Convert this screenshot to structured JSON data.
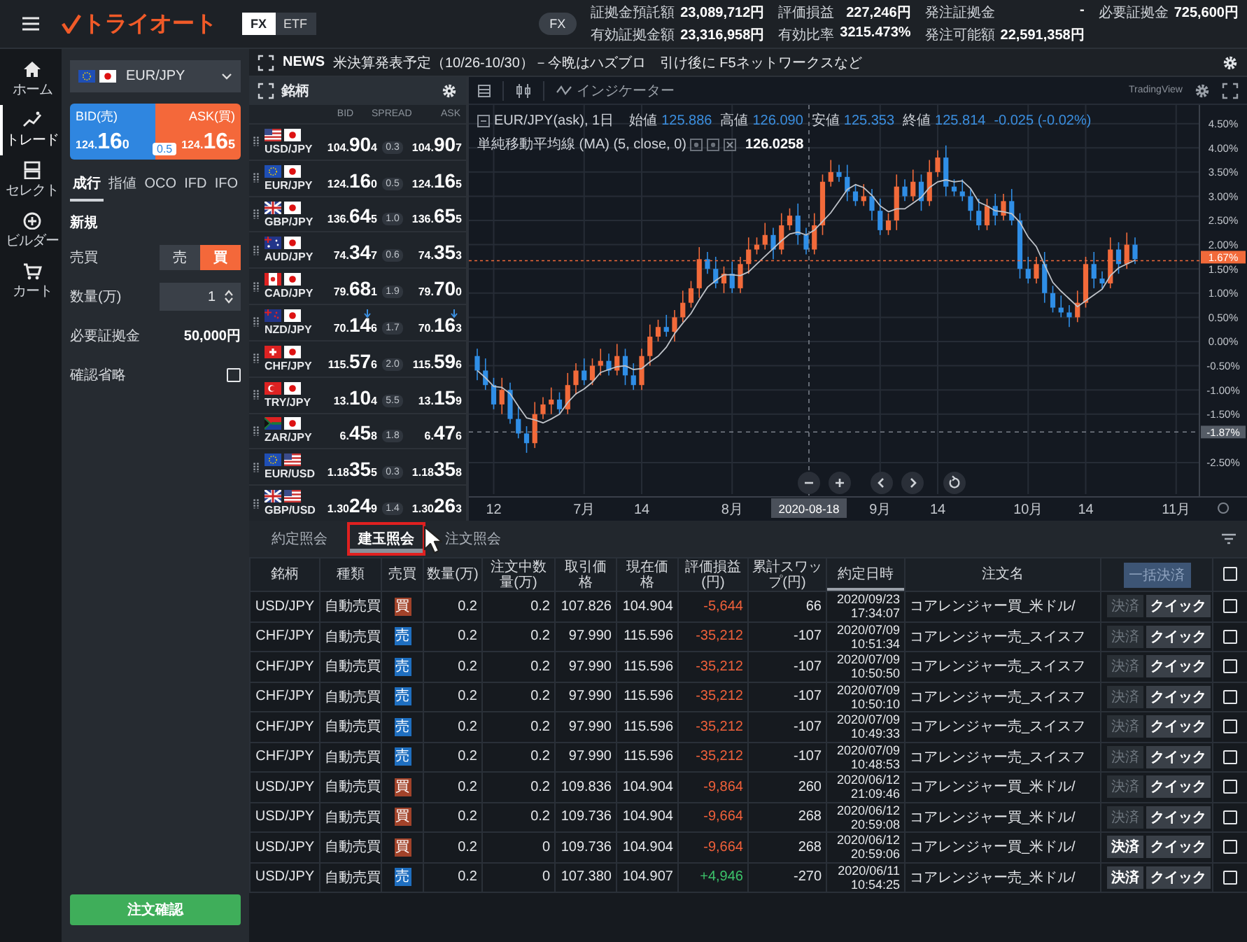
{
  "topbar": {
    "logo": "トライオート",
    "tabs": [
      {
        "label": "FX",
        "selected": true
      },
      {
        "label": "ETF",
        "selected": false
      }
    ],
    "badge": "FX",
    "summary": [
      {
        "label": "証拠金預託額",
        "value": "23,089,712円"
      },
      {
        "label": "評価損益",
        "value": "227,246円"
      },
      {
        "label": "発注証拠金",
        "value": "-"
      },
      {
        "label": "必要証拠金",
        "value": "725,600円"
      },
      {
        "label": "有効証拠金額",
        "value": "23,316,958円"
      },
      {
        "label": "有効比率",
        "value": "3215.473%"
      },
      {
        "label": "発注可能額",
        "value": "22,591,358円"
      }
    ]
  },
  "nav": [
    {
      "label": "ホーム",
      "kind": "home",
      "selected": false
    },
    {
      "label": "トレード",
      "kind": "trade",
      "selected": true
    },
    {
      "label": "セレクト",
      "kind": "select",
      "selected": false
    },
    {
      "label": "ビルダー",
      "kind": "builder",
      "selected": false
    },
    {
      "label": "カート",
      "kind": "cart",
      "selected": false
    }
  ],
  "order_panel": {
    "pair": "EUR/JPY",
    "flags": [
      {
        "kind": "eu"
      },
      {
        "kind": "jp"
      }
    ],
    "bid": {
      "label": "BID(売)",
      "price": [
        "124.",
        "16",
        "0"
      ]
    },
    "spread": "0.5",
    "ask": {
      "label": "ASK(買)",
      "price": [
        "124.",
        "16",
        "5"
      ]
    },
    "order_types": [
      {
        "label": "成行",
        "selected": true
      },
      {
        "label": "指値",
        "selected": false
      },
      {
        "label": "OCO",
        "selected": false
      },
      {
        "label": "IFD",
        "selected": false
      },
      {
        "label": "IFO",
        "selected": false
      }
    ],
    "section": "新規",
    "side_label": "売買",
    "sides": [
      {
        "label": "売",
        "kind": "sell",
        "selected": false
      },
      {
        "label": "買",
        "kind": "buy",
        "selected": true
      }
    ],
    "quantity_label": "数量(万)",
    "quantity": "1",
    "margin_label": "必要証拠金",
    "margin": "50,000円",
    "skip_confirm_label": "確認省略",
    "skip_confirm": false,
    "submit": "注文確認"
  },
  "news": {
    "label": "NEWS",
    "text": "米決算発表予定（10/26-10/30）－今晩はハズブロ　引け後に F5ネットワークスなど"
  },
  "rates": {
    "title": "銘柄",
    "columns": [
      "BID",
      "SPREAD",
      "ASK"
    ],
    "rows": [
      {
        "pair": "USD/JPY",
        "flags": [
          {
            "kind": "us"
          },
          {
            "kind": "jp"
          }
        ],
        "bid": [
          "104.",
          "90",
          "4"
        ],
        "spread": "0.3",
        "ask": [
          "104.",
          "90",
          "7"
        ],
        "tick_down": false
      },
      {
        "pair": "EUR/JPY",
        "flags": [
          {
            "kind": "eu"
          },
          {
            "kind": "jp"
          }
        ],
        "bid": [
          "124.",
          "16",
          "0"
        ],
        "spread": "0.5",
        "ask": [
          "124.",
          "16",
          "5"
        ],
        "tick_down": false
      },
      {
        "pair": "GBP/JPY",
        "flags": [
          {
            "kind": "gb"
          },
          {
            "kind": "jp"
          }
        ],
        "bid": [
          "136.",
          "64",
          "5"
        ],
        "spread": "1.0",
        "ask": [
          "136.",
          "65",
          "5"
        ],
        "tick_down": false
      },
      {
        "pair": "AUD/JPY",
        "flags": [
          {
            "kind": "au"
          },
          {
            "kind": "jp"
          }
        ],
        "bid": [
          "74.",
          "34",
          "7"
        ],
        "spread": "0.6",
        "ask": [
          "74.",
          "35",
          "3"
        ],
        "tick_down": false
      },
      {
        "pair": "CAD/JPY",
        "flags": [
          {
            "kind": "ca"
          },
          {
            "kind": "jp"
          }
        ],
        "bid": [
          "79.",
          "68",
          "1"
        ],
        "spread": "1.9",
        "ask": [
          "79.",
          "70",
          "0"
        ],
        "tick_down": false
      },
      {
        "pair": "NZD/JPY",
        "flags": [
          {
            "kind": "nz"
          },
          {
            "kind": "jp"
          }
        ],
        "bid": [
          "70.",
          "14",
          "6"
        ],
        "spread": "1.7",
        "ask": [
          "70.",
          "16",
          "3"
        ],
        "tick_down": true
      },
      {
        "pair": "CHF/JPY",
        "flags": [
          {
            "kind": "ch"
          },
          {
            "kind": "jp"
          }
        ],
        "bid": [
          "115.",
          "57",
          "6"
        ],
        "spread": "2.0",
        "ask": [
          "115.",
          "59",
          "6"
        ],
        "tick_down": false
      },
      {
        "pair": "TRY/JPY",
        "flags": [
          {
            "kind": "tr"
          },
          {
            "kind": "jp"
          }
        ],
        "bid": [
          "13.",
          "10",
          "4"
        ],
        "spread": "5.5",
        "ask": [
          "13.",
          "15",
          "9"
        ],
        "tick_down": false
      },
      {
        "pair": "ZAR/JPY",
        "flags": [
          {
            "kind": "za"
          },
          {
            "kind": "jp"
          }
        ],
        "bid": [
          "6.",
          "45",
          "8"
        ],
        "spread": "1.8",
        "ask": [
          "6.",
          "47",
          "6"
        ],
        "tick_down": false
      },
      {
        "pair": "EUR/USD",
        "flags": [
          {
            "kind": "eu"
          },
          {
            "kind": "us"
          }
        ],
        "bid": [
          "1.18",
          "35",
          "5"
        ],
        "spread": "0.3",
        "ask": [
          "1.18",
          "35",
          "8"
        ],
        "tick_down": false
      },
      {
        "pair": "GBP/USD",
        "flags": [
          {
            "kind": "gb"
          },
          {
            "kind": "us"
          }
        ],
        "bid": [
          "1.30",
          "24",
          "9"
        ],
        "spread": "1.4",
        "ask": [
          "1.30",
          "26",
          "3"
        ],
        "tick_down": false
      }
    ]
  },
  "chart": {
    "indicators": "インジケーター",
    "brand": "TradingView",
    "symbol": "EUR/JPY(ask), 1日",
    "ohlc": [
      {
        "label": "始値",
        "value": "125.886"
      },
      {
        "label": "高値",
        "value": "126.090"
      },
      {
        "label": "安値",
        "value": "125.353"
      },
      {
        "label": "終値",
        "value": "125.814"
      }
    ],
    "change": "-0.025 (-0.02%)",
    "ma_value": "126.0258",
    "crosshair_date": "2020-08-18",
    "chart_data": {
      "type": "candlestick",
      "grid": true,
      "ylim": [
        -3.21,
        4.886
      ],
      "ref_lines": [
        {
          "axis": "y",
          "value": 1.67,
          "label": "1.67%",
          "color": "#f26a3a"
        },
        {
          "axis": "y",
          "value": -1.87,
          "label": "-1.87%",
          "color": "#7a808a"
        }
      ],
      "categories": [
        null,
        null,
        "12",
        null,
        null,
        null,
        null,
        null,
        null,
        null,
        null,
        null,
        null,
        "7月",
        null,
        null,
        null,
        null,
        null,
        null,
        "14",
        null,
        null,
        null,
        null,
        null,
        null,
        null,
        null,
        null,
        null,
        "8月",
        null,
        null,
        null,
        null,
        null,
        null,
        null,
        null,
        null,
        null,
        null,
        null,
        null,
        null,
        null,
        null,
        null,
        "9月",
        null,
        null,
        null,
        null,
        null,
        null,
        "14",
        null,
        null,
        null,
        null,
        null,
        null,
        null,
        null,
        null,
        null,
        "10月",
        null,
        null,
        null,
        null,
        null,
        null,
        "14",
        null,
        null,
        null,
        null,
        null,
        null,
        null,
        null,
        null,
        null,
        "11月",
        null,
        null
      ],
      "yticks": [
        {
          "value": 4.5,
          "label": "4.50%"
        },
        {
          "value": 4,
          "label": "4.00%"
        },
        {
          "value": 3.5,
          "label": "3.50%"
        },
        {
          "value": 3,
          "label": "3.00%"
        },
        {
          "value": 2.5,
          "label": "2.50%"
        },
        {
          "value": 2,
          "label": "2.00%"
        },
        {
          "value": 1.5,
          "label": "1.50%"
        },
        {
          "value": 1,
          "label": "1.00%"
        },
        {
          "value": 0.5,
          "label": "0.50%"
        },
        {
          "value": 0,
          "label": "0.00%"
        },
        {
          "value": -0.5,
          "label": "-0.50%"
        },
        {
          "value": -1,
          "label": "-1.00%"
        },
        {
          "value": -1.5,
          "label": "-1.50%"
        },
        {
          "value": -2.5,
          "label": "-2.50%"
        }
      ],
      "ohlc": [
        [
          -0.3,
          -0.15,
          -0.8,
          -0.6
        ],
        [
          -0.6,
          -0.35,
          -1.0,
          -0.9
        ],
        [
          -0.9,
          -0.75,
          -1.4,
          -1.3
        ],
        [
          -1.3,
          -0.75,
          -1.5,
          -1.0
        ],
        [
          -1.0,
          -0.85,
          -1.7,
          -1.6
        ],
        [
          -1.6,
          -1.35,
          -2.0,
          -1.9
        ],
        [
          -1.9,
          -1.75,
          -2.3,
          -2.1
        ],
        [
          -2.1,
          -1.25,
          -2.2,
          -1.5
        ],
        [
          -1.5,
          -1.15,
          -1.6,
          -1.3
        ],
        [
          -1.3,
          -0.95,
          -1.5,
          -1.2
        ],
        [
          -1.2,
          -1.05,
          -1.5,
          -1.4
        ],
        [
          -1.4,
          -0.65,
          -1.5,
          -0.9
        ],
        [
          -0.9,
          -0.45,
          -1.1,
          -0.6
        ],
        [
          -0.6,
          -0.35,
          -0.9,
          -0.8
        ],
        [
          -0.8,
          -0.35,
          -0.9,
          -0.5
        ],
        [
          -0.5,
          -0.15,
          -0.7,
          -0.4
        ],
        [
          -0.4,
          -0.25,
          -0.7,
          -0.6
        ],
        [
          -0.6,
          -0.05,
          -0.7,
          -0.3
        ],
        [
          -0.3,
          -0.15,
          -0.9,
          -0.7
        ],
        [
          -0.7,
          -0.45,
          -1.0,
          -0.9
        ],
        [
          -0.9,
          -0.15,
          -1.0,
          -0.3
        ],
        [
          -0.3,
          0.35,
          -0.5,
          0.1
        ],
        [
          0.1,
          0.45,
          0,
          0.3
        ],
        [
          0.3,
          0.55,
          0.1,
          0.2
        ],
        [
          0.2,
          0.65,
          0,
          0.5
        ],
        [
          0.5,
          1.05,
          0.4,
          0.8
        ],
        [
          0.8,
          1.25,
          0.7,
          1.1
        ],
        [
          1.1,
          1.95,
          0.9,
          1.7
        ],
        [
          1.7,
          1.85,
          1.4,
          1.5
        ],
        [
          1.5,
          1.75,
          1.1,
          1.2
        ],
        [
          1.2,
          1.55,
          1.0,
          1.4
        ],
        [
          1.4,
          1.65,
          1.0,
          1.1
        ],
        [
          1.1,
          1.75,
          1.0,
          1.6
        ],
        [
          1.6,
          2.15,
          1.4,
          1.9
        ],
        [
          1.9,
          2.15,
          1.8,
          2.0
        ],
        [
          2.0,
          2.45,
          1.9,
          2.2
        ],
        [
          2.2,
          2.35,
          1.7,
          1.9
        ],
        [
          1.9,
          2.65,
          1.8,
          2.4
        ],
        [
          2.4,
          2.75,
          2.3,
          2.6
        ],
        [
          2.6,
          2.85,
          2.0,
          2.2
        ],
        [
          2.2,
          2.35,
          1.8,
          1.9
        ],
        [
          1.9,
          2.65,
          1.8,
          2.4
        ],
        [
          2.4,
          3.45,
          2.2,
          3.3
        ],
        [
          3.3,
          3.75,
          3.2,
          3.5
        ],
        [
          3.5,
          3.65,
          3.3,
          3.4
        ],
        [
          3.4,
          3.65,
          2.9,
          3.1
        ],
        [
          3.1,
          3.25,
          2.8,
          2.9
        ],
        [
          2.9,
          3.25,
          2.8,
          3.0
        ],
        [
          3.0,
          3.15,
          2.5,
          2.7
        ],
        [
          2.7,
          2.95,
          2.2,
          2.3
        ],
        [
          2.3,
          2.65,
          2.2,
          2.5
        ],
        [
          2.5,
          3.45,
          2.3,
          3.2
        ],
        [
          3.2,
          3.35,
          2.9,
          3.0
        ],
        [
          3.0,
          3.55,
          2.9,
          3.3
        ],
        [
          3.3,
          3.45,
          2.7,
          2.9
        ],
        [
          2.9,
          3.75,
          2.8,
          3.5
        ],
        [
          3.5,
          3.95,
          3.4,
          3.8
        ],
        [
          3.8,
          4.05,
          3.0,
          3.2
        ],
        [
          3.2,
          3.35,
          3.0,
          3.1
        ],
        [
          3.1,
          3.35,
          2.9,
          3.0
        ],
        [
          3.0,
          3.15,
          2.5,
          2.7
        ],
        [
          2.7,
          2.95,
          2.3,
          2.4
        ],
        [
          2.4,
          2.95,
          2.3,
          2.8
        ],
        [
          2.8,
          3.05,
          2.4,
          2.6
        ],
        [
          2.6,
          3.05,
          2.5,
          2.9
        ],
        [
          2.9,
          3.15,
          2.4,
          2.5
        ],
        [
          2.5,
          2.65,
          1.3,
          1.5
        ],
        [
          1.5,
          1.75,
          1.2,
          1.3
        ],
        [
          1.3,
          1.75,
          1.2,
          1.6
        ],
        [
          1.6,
          1.85,
          0.8,
          1.0
        ],
        [
          1.0,
          1.15,
          0.6,
          0.7
        ],
        [
          0.7,
          0.95,
          0.5,
          0.6
        ],
        [
          0.6,
          0.75,
          0.3,
          0.5
        ],
        [
          0.5,
          1.05,
          0.4,
          0.8
        ],
        [
          0.8,
          1.75,
          0.7,
          1.6
        ],
        [
          1.6,
          1.85,
          1.1,
          1.3
        ],
        [
          1.3,
          1.45,
          1.1,
          1.2
        ],
        [
          1.2,
          2.15,
          1.1,
          1.9
        ],
        [
          1.9,
          2.05,
          1.4,
          1.6
        ],
        [
          1.6,
          2.25,
          1.5,
          2.0
        ],
        [
          2.0,
          2.15,
          1.6,
          1.7
        ],
        null,
        null,
        null,
        null,
        null,
        null,
        null
      ],
      "series": [
        {
          "name": "単純移動平均線 (MA) (5, close, 0)",
          "type": "line",
          "color": "#bfc3c9",
          "values": [
            -0.6,
            -0.75,
            -0.93,
            -0.95,
            -1.08,
            -1.34,
            -1.58,
            -1.62,
            -1.68,
            -1.6,
            -1.5,
            -1.26,
            -1.08,
            -0.98,
            -0.84,
            -0.64,
            -0.58,
            -0.52,
            -0.5,
            -0.58,
            -0.56,
            -0.42,
            -0.3,
            -0.12,
            0.16,
            0.38,
            0.58,
            0.86,
            1.12,
            1.26,
            1.38,
            1.38,
            1.36,
            1.44,
            1.6,
            1.76,
            1.92,
            2.08,
            2.22,
            2.26,
            2.2,
            2.3,
            2.48,
            2.66,
            2.9,
            3.14,
            3.24,
            3.18,
            3.02,
            2.8,
            2.68,
            2.74,
            2.74,
            2.86,
            2.98,
            3.18,
            3.3,
            3.34,
            3.3,
            3.32,
            3.16,
            2.88,
            2.8,
            2.7,
            2.68,
            2.64,
            2.46,
            2.16,
            1.96,
            1.58,
            1.22,
            1.04,
            0.88,
            0.72,
            0.84,
            0.96,
            1.08,
            1.36,
            1.52,
            1.6,
            1.68,
            null,
            null,
            null,
            null,
            null,
            null,
            null
          ]
        }
      ]
    }
  },
  "positions": {
    "tabs": [
      {
        "label": "約定照会",
        "selected": false,
        "highlighted": false
      },
      {
        "label": "建玉照会",
        "selected": true,
        "highlighted": true
      },
      {
        "label": "注文照会",
        "selected": false,
        "highlighted": false
      }
    ],
    "columns": [
      {
        "label": "銘柄",
        "sorted": false
      },
      {
        "label": "種類",
        "sorted": false
      },
      {
        "label": "売買",
        "sorted": false
      },
      {
        "label": "数量(万)",
        "sorted": false
      },
      {
        "label": "注文中数量(万)",
        "sorted": false
      },
      {
        "label": "取引価格",
        "sorted": false
      },
      {
        "label": "現在価格",
        "sorted": false
      },
      {
        "label": "評価損益(円)",
        "sorted": false
      },
      {
        "label": "累計スワップ(円)",
        "sorted": false
      },
      {
        "label": "約定日時",
        "sorted": true
      },
      {
        "label": "注文名",
        "sorted": false
      }
    ],
    "bulk_settle": {
      "label": "一括決済",
      "disabled": true
    },
    "select_all": false,
    "rows": [
      {
        "pair": "USD/JPY",
        "type": "自動売買",
        "kind": "buy",
        "side_label": "買",
        "qty": "0.2",
        "pending": "0.2",
        "price": "107.826",
        "current": "104.904",
        "pnl": "-5,644",
        "pnl_positive": false,
        "swap": "66",
        "date": "2020/09/23",
        "time": "17:34:07",
        "name": "コアレンジャー買_米ドル/",
        "settle": "決済",
        "settle_enabled": false,
        "quick": "クイック",
        "checked": false
      },
      {
        "pair": "CHF/JPY",
        "type": "自動売買",
        "kind": "sell",
        "side_label": "売",
        "qty": "0.2",
        "pending": "0.2",
        "price": "97.990",
        "current": "115.596",
        "pnl": "-35,212",
        "pnl_positive": false,
        "swap": "-107",
        "date": "2020/07/09",
        "time": "10:51:34",
        "name": "コアレンジャー売_スイスフ",
        "settle": "決済",
        "settle_enabled": false,
        "quick": "クイック",
        "checked": false
      },
      {
        "pair": "CHF/JPY",
        "type": "自動売買",
        "kind": "sell",
        "side_label": "売",
        "qty": "0.2",
        "pending": "0.2",
        "price": "97.990",
        "current": "115.596",
        "pnl": "-35,212",
        "pnl_positive": false,
        "swap": "-107",
        "date": "2020/07/09",
        "time": "10:50:50",
        "name": "コアレンジャー売_スイスフ",
        "settle": "決済",
        "settle_enabled": false,
        "quick": "クイック",
        "checked": false
      },
      {
        "pair": "CHF/JPY",
        "type": "自動売買",
        "kind": "sell",
        "side_label": "売",
        "qty": "0.2",
        "pending": "0.2",
        "price": "97.990",
        "current": "115.596",
        "pnl": "-35,212",
        "pnl_positive": false,
        "swap": "-107",
        "date": "2020/07/09",
        "time": "10:50:10",
        "name": "コアレンジャー売_スイスフ",
        "settle": "決済",
        "settle_enabled": false,
        "quick": "クイック",
        "checked": false
      },
      {
        "pair": "CHF/JPY",
        "type": "自動売買",
        "kind": "sell",
        "side_label": "売",
        "qty": "0.2",
        "pending": "0.2",
        "price": "97.990",
        "current": "115.596",
        "pnl": "-35,212",
        "pnl_positive": false,
        "swap": "-107",
        "date": "2020/07/09",
        "time": "10:49:33",
        "name": "コアレンジャー売_スイスフ",
        "settle": "決済",
        "settle_enabled": false,
        "quick": "クイック",
        "checked": false
      },
      {
        "pair": "CHF/JPY",
        "type": "自動売買",
        "kind": "sell",
        "side_label": "売",
        "qty": "0.2",
        "pending": "0.2",
        "price": "97.990",
        "current": "115.596",
        "pnl": "-35,212",
        "pnl_positive": false,
        "swap": "-107",
        "date": "2020/07/09",
        "time": "10:48:53",
        "name": "コアレンジャー売_スイスフ",
        "settle": "決済",
        "settle_enabled": false,
        "quick": "クイック",
        "checked": false
      },
      {
        "pair": "USD/JPY",
        "type": "自動売買",
        "kind": "buy",
        "side_label": "買",
        "qty": "0.2",
        "pending": "0.2",
        "price": "109.836",
        "current": "104.904",
        "pnl": "-9,864",
        "pnl_positive": false,
        "swap": "260",
        "date": "2020/06/12",
        "time": "21:09:46",
        "name": "コアレンジャー買_米ドル/",
        "settle": "決済",
        "settle_enabled": false,
        "quick": "クイック",
        "checked": false
      },
      {
        "pair": "USD/JPY",
        "type": "自動売買",
        "kind": "buy",
        "side_label": "買",
        "qty": "0.2",
        "pending": "0.2",
        "price": "109.736",
        "current": "104.904",
        "pnl": "-9,664",
        "pnl_positive": false,
        "swap": "268",
        "date": "2020/06/12",
        "time": "20:59:08",
        "name": "コアレンジャー買_米ドル/",
        "settle": "決済",
        "settle_enabled": false,
        "quick": "クイック",
        "checked": false
      },
      {
        "pair": "USD/JPY",
        "type": "自動売買",
        "kind": "buy",
        "side_label": "買",
        "qty": "0.2",
        "pending": "0",
        "price": "109.736",
        "current": "104.904",
        "pnl": "-9,664",
        "pnl_positive": false,
        "swap": "268",
        "date": "2020/06/12",
        "time": "20:59:06",
        "name": "コアレンジャー買_米ドル/",
        "settle": "決済",
        "settle_enabled": true,
        "quick": "クイック",
        "checked": false
      },
      {
        "pair": "USD/JPY",
        "type": "自動売買",
        "kind": "sell",
        "side_label": "売",
        "qty": "0.2",
        "pending": "0",
        "price": "107.380",
        "current": "104.907",
        "pnl": "+4,946",
        "pnl_positive": true,
        "swap": "-270",
        "date": "2020/06/11",
        "time": "10:54:25",
        "name": "コアレンジャー売_米ドル/",
        "settle": "決済",
        "settle_enabled": true,
        "quick": "クイック",
        "checked": false
      }
    ]
  }
}
